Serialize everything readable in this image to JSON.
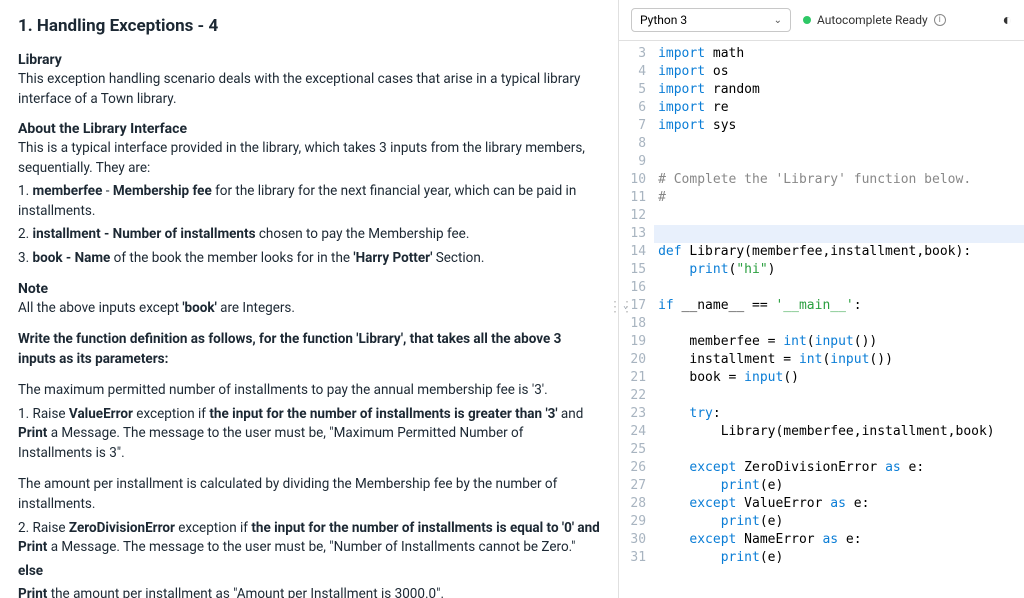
{
  "title": "1. Handling Exceptions - 4",
  "sections": {
    "library_h": "Library",
    "library_p": "This exception handling scenario deals with the exceptional cases that arise in a typical library interface of a Town library.",
    "about_h": "About the Library Interface",
    "about_p": "This is a typical interface provided in the library, which takes 3 inputs from the library members, sequentially. They are:",
    "item1_a": "1. ",
    "item1_b": "memberfee",
    "item1_c": " - ",
    "item1_d": "Membership fee",
    "item1_e": " for the library for the next financial year, which can be paid in installments.",
    "item2_a": "2. ",
    "item2_b": "installment - Number of installments",
    "item2_c": " chosen to pay the Membership fee.",
    "item3_a": "3. ",
    "item3_b": "book - Name",
    "item3_c": " of the book the member looks for in the ",
    "item3_d": "'Harry Potter'",
    "item3_e": " Section.",
    "note_h": "Note",
    "note_a": "All the above inputs except ",
    "note_b": "'book'",
    "note_c": " are Integers.",
    "write_a": "Write the function definition as follows, for the function 'Library', that takes all the above 3 inputs as its parameters:",
    "max_p": "The maximum permitted number of installments to pay the annual membership fee is '3'.",
    "raise1_a": "1. Raise ",
    "raise1_b": "ValueError",
    "raise1_c": " exception if ",
    "raise1_d": "the input for the number of installments is greater than '3'",
    "raise1_e": " and ",
    "raise1_f": "Print",
    "raise1_g": " a Message. The message to the user must be, \"Maximum Permitted Number of Installments is 3\".",
    "amt_p": "The amount per installment is calculated by dividing the Membership fee by the number of installments.",
    "raise2_a": "2. Raise ",
    "raise2_b": "ZeroDivisionError",
    "raise2_c": " exception if ",
    "raise2_d": "the input for the number of installments is equal to '0' and Print",
    "raise2_e": " a Message. The message to the user must be, \"Number of Installments cannot be Zero.\"",
    "else_a": "else",
    "else_b": "Print",
    "else_c": " the amount per installment as \"Amount per Installment is 3000.0\"."
  },
  "editor": {
    "language": "Python 3",
    "autocomplete": "Autocomplete Ready",
    "lines": [
      {
        "n": 3,
        "tokens": [
          {
            "t": "import",
            "c": "kw"
          },
          {
            "t": " math"
          }
        ]
      },
      {
        "n": 4,
        "tokens": [
          {
            "t": "import",
            "c": "kw"
          },
          {
            "t": " os"
          }
        ]
      },
      {
        "n": 5,
        "tokens": [
          {
            "t": "import",
            "c": "kw"
          },
          {
            "t": " random"
          }
        ]
      },
      {
        "n": 6,
        "tokens": [
          {
            "t": "import",
            "c": "kw"
          },
          {
            "t": " re"
          }
        ]
      },
      {
        "n": 7,
        "tokens": [
          {
            "t": "import",
            "c": "kw"
          },
          {
            "t": " sys"
          }
        ]
      },
      {
        "n": 8,
        "tokens": []
      },
      {
        "n": 9,
        "tokens": []
      },
      {
        "n": 10,
        "tokens": [
          {
            "t": "# Complete the 'Library' function below.",
            "c": "cm"
          }
        ]
      },
      {
        "n": 11,
        "tokens": [
          {
            "t": "#",
            "c": "cm"
          }
        ]
      },
      {
        "n": 12,
        "tokens": []
      },
      {
        "n": 13,
        "tokens": [],
        "hl": true
      },
      {
        "n": 14,
        "tokens": [
          {
            "t": "def",
            "c": "kw"
          },
          {
            "t": " Library(memberfee,installment,book):"
          }
        ]
      },
      {
        "n": 15,
        "tokens": [
          {
            "t": "    "
          },
          {
            "t": "print",
            "c": "kw2"
          },
          {
            "t": "("
          },
          {
            "t": "\"hi\"",
            "c": "str"
          },
          {
            "t": ")"
          }
        ]
      },
      {
        "n": 16,
        "tokens": []
      },
      {
        "n": 17,
        "fold": true,
        "tokens": [
          {
            "t": "if",
            "c": "kw"
          },
          {
            "t": " __name__ == "
          },
          {
            "t": "'__main__'",
            "c": "str"
          },
          {
            "t": ":"
          }
        ]
      },
      {
        "n": 18,
        "tokens": []
      },
      {
        "n": 19,
        "tokens": [
          {
            "t": "    memberfee = "
          },
          {
            "t": "int",
            "c": "kw2"
          },
          {
            "t": "("
          },
          {
            "t": "input",
            "c": "kw2"
          },
          {
            "t": "())"
          }
        ]
      },
      {
        "n": 20,
        "tokens": [
          {
            "t": "    installment = "
          },
          {
            "t": "int",
            "c": "kw2"
          },
          {
            "t": "("
          },
          {
            "t": "input",
            "c": "kw2"
          },
          {
            "t": "())"
          }
        ]
      },
      {
        "n": 21,
        "tokens": [
          {
            "t": "    book = "
          },
          {
            "t": "input",
            "c": "kw2"
          },
          {
            "t": "()"
          }
        ]
      },
      {
        "n": 22,
        "tokens": []
      },
      {
        "n": 23,
        "tokens": [
          {
            "t": "    "
          },
          {
            "t": "try",
            "c": "kw"
          },
          {
            "t": ":"
          }
        ]
      },
      {
        "n": 24,
        "tokens": [
          {
            "t": "        Library(memberfee,installment,book)"
          }
        ]
      },
      {
        "n": 25,
        "tokens": []
      },
      {
        "n": 26,
        "tokens": [
          {
            "t": "    "
          },
          {
            "t": "except",
            "c": "kw"
          },
          {
            "t": " ZeroDivisionError "
          },
          {
            "t": "as",
            "c": "kw"
          },
          {
            "t": " e:"
          }
        ]
      },
      {
        "n": 27,
        "tokens": [
          {
            "t": "        "
          },
          {
            "t": "print",
            "c": "kw2"
          },
          {
            "t": "(e)"
          }
        ]
      },
      {
        "n": 28,
        "tokens": [
          {
            "t": "    "
          },
          {
            "t": "except",
            "c": "kw"
          },
          {
            "t": " ValueError "
          },
          {
            "t": "as",
            "c": "kw"
          },
          {
            "t": " e:"
          }
        ]
      },
      {
        "n": 29,
        "tokens": [
          {
            "t": "        "
          },
          {
            "t": "print",
            "c": "kw2"
          },
          {
            "t": "(e)"
          }
        ]
      },
      {
        "n": 30,
        "tokens": [
          {
            "t": "    "
          },
          {
            "t": "except",
            "c": "kw"
          },
          {
            "t": " NameError "
          },
          {
            "t": "as",
            "c": "kw"
          },
          {
            "t": " e:"
          }
        ]
      },
      {
        "n": 31,
        "tokens": [
          {
            "t": "        "
          },
          {
            "t": "print",
            "c": "kw2"
          },
          {
            "t": "(e)"
          }
        ]
      }
    ]
  }
}
